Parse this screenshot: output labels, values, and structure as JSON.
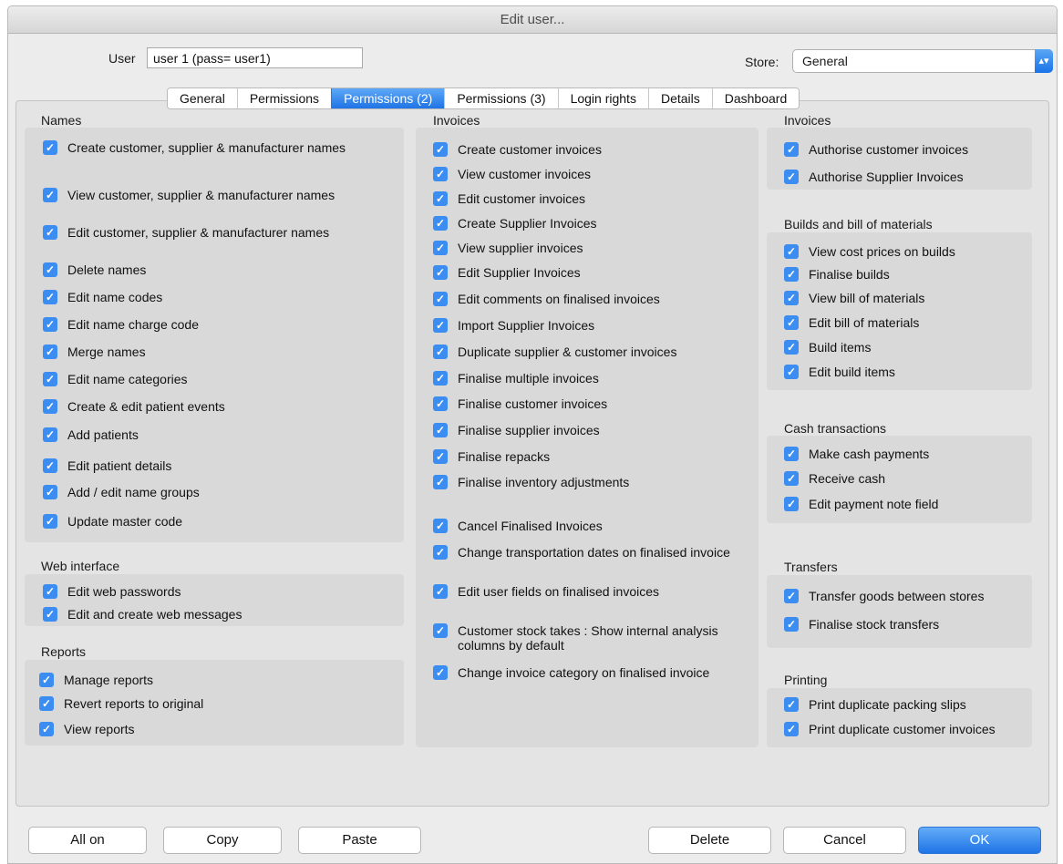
{
  "window": {
    "title": "Edit user..."
  },
  "header": {
    "user_label": "User",
    "user_value": "user 1 (pass= user1)",
    "store_label": "Store:",
    "store_value": "General",
    "store_arrow_icon": "updown-arrow-icon"
  },
  "tabs": [
    {
      "label": "General",
      "active": false
    },
    {
      "label": "Permissions",
      "active": false
    },
    {
      "label": "Permissions (2)",
      "active": true
    },
    {
      "label": "Permissions (3)",
      "active": false
    },
    {
      "label": "Login rights",
      "active": false
    },
    {
      "label": "Details",
      "active": false
    },
    {
      "label": "Dashboard",
      "active": false
    }
  ],
  "checkbox_icon": "checkmark-icon",
  "sections": {
    "names": {
      "title": "Names",
      "items": [
        {
          "label": "Create customer, supplier & manufacturer names",
          "checked": true
        },
        {
          "label": "View customer, supplier & manufacturer names",
          "checked": true
        },
        {
          "label": "Edit customer, supplier & manufacturer names",
          "checked": true
        },
        {
          "label": "Delete names",
          "checked": true
        },
        {
          "label": "Edit name codes",
          "checked": true
        },
        {
          "label": "Edit name charge code",
          "checked": true
        },
        {
          "label": "Merge names",
          "checked": true
        },
        {
          "label": "Edit name categories",
          "checked": true
        },
        {
          "label": "Create & edit patient events",
          "checked": true
        },
        {
          "label": "Add patients",
          "checked": true
        },
        {
          "label": "Edit patient details",
          "checked": true
        },
        {
          "label": "Add / edit name groups",
          "checked": true
        },
        {
          "label": "Update master code",
          "checked": true
        }
      ]
    },
    "web_interface": {
      "title": "Web interface",
      "items": [
        {
          "label": "Edit web passwords",
          "checked": true
        },
        {
          "label": "Edit and create web messages",
          "checked": true
        }
      ]
    },
    "reports": {
      "title": "Reports",
      "items": [
        {
          "label": "Manage reports",
          "checked": true
        },
        {
          "label": "Revert reports to original",
          "checked": true
        },
        {
          "label": "View reports",
          "checked": true
        }
      ]
    },
    "invoices": {
      "title": "Invoices",
      "items": [
        {
          "label": "Create customer  invoices",
          "checked": true
        },
        {
          "label": "View customer invoices",
          "checked": true
        },
        {
          "label": "Edit customer invoices",
          "checked": true
        },
        {
          "label": "Create Supplier Invoices",
          "checked": true
        },
        {
          "label": "View supplier invoices",
          "checked": true
        },
        {
          "label": "Edit Supplier Invoices",
          "checked": true
        },
        {
          "label": "Edit comments on finalised invoices",
          "checked": true
        },
        {
          "label": "Import Supplier Invoices",
          "checked": true
        },
        {
          "label": "Duplicate supplier & customer invoices",
          "checked": true
        },
        {
          "label": "Finalise multiple invoices",
          "checked": true
        },
        {
          "label": "Finalise customer invoices",
          "checked": true
        },
        {
          "label": "Finalise supplier invoices",
          "checked": true
        },
        {
          "label": "Finalise repacks",
          "checked": true
        },
        {
          "label": "Finalise inventory adjustments",
          "checked": true
        },
        {
          "label": "Cancel Finalised Invoices",
          "checked": true
        },
        {
          "label": "Change transportation dates on finalised invoice",
          "checked": true
        },
        {
          "label": "Edit user fields on finalised invoices",
          "checked": true
        },
        {
          "label": "Customer stock takes : Show internal analysis columns by default",
          "checked": true
        },
        {
          "label": "Change invoice category on finalised invoice",
          "checked": true
        }
      ]
    },
    "invoices_auth": {
      "title": "Invoices",
      "items": [
        {
          "label": "Authorise customer invoices",
          "checked": true
        },
        {
          "label": "Authorise Supplier Invoices",
          "checked": true
        }
      ]
    },
    "builds": {
      "title": "Builds and bill of materials",
      "items": [
        {
          "label": "View cost prices on builds",
          "checked": true
        },
        {
          "label": "Finalise builds",
          "checked": true
        },
        {
          "label": "View bill of materials",
          "checked": true
        },
        {
          "label": "Edit bill of materials",
          "checked": true
        },
        {
          "label": "Build items",
          "checked": true
        },
        {
          "label": "Edit build items",
          "checked": true
        }
      ]
    },
    "cash": {
      "title": "Cash transactions",
      "items": [
        {
          "label": "Make cash payments",
          "checked": true
        },
        {
          "label": "Receive cash",
          "checked": true
        },
        {
          "label": "Edit payment note field",
          "checked": true
        }
      ]
    },
    "transfers": {
      "title": "Transfers",
      "items": [
        {
          "label": "Transfer goods between stores",
          "checked": true
        },
        {
          "label": "Finalise stock transfers",
          "checked": true
        }
      ]
    },
    "printing": {
      "title": "Printing",
      "items": [
        {
          "label": "Print duplicate packing slips",
          "checked": true
        },
        {
          "label": "Print duplicate customer invoices",
          "checked": true
        }
      ]
    }
  },
  "buttons": {
    "all_on": "All on",
    "copy": "Copy",
    "paste": "Paste",
    "delete": "Delete",
    "cancel": "Cancel",
    "ok": "OK"
  }
}
